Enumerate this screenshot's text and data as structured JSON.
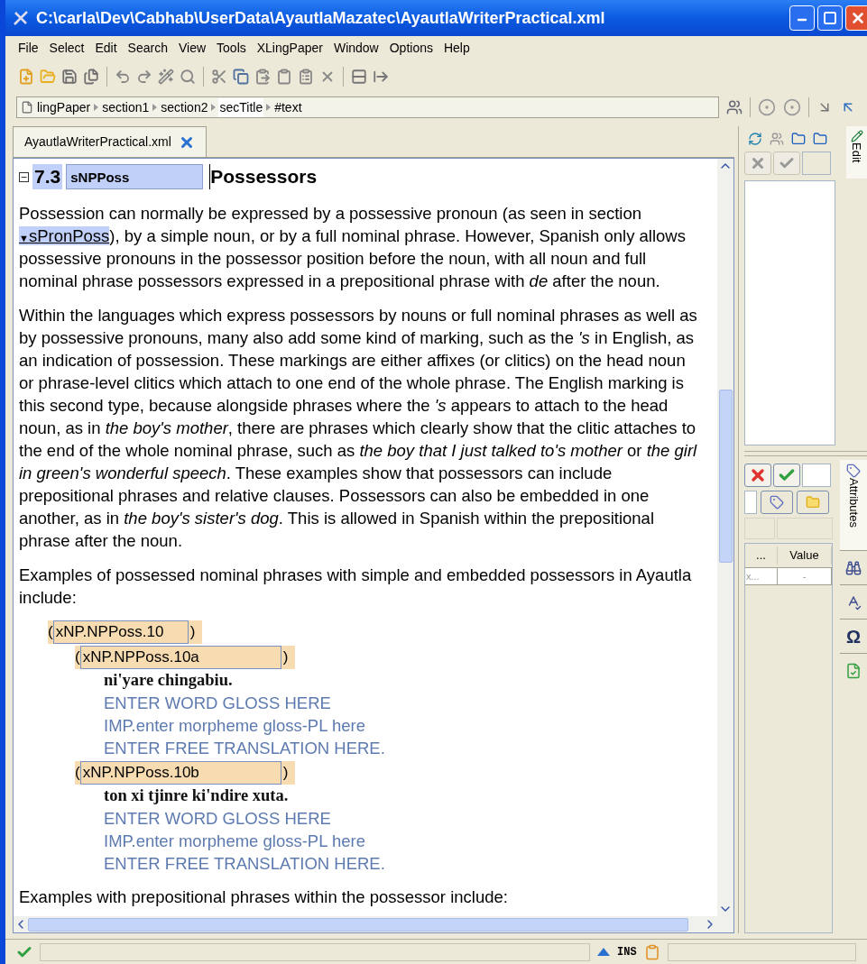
{
  "window": {
    "title": "C:\\carla\\Dev\\Cabhab\\UserData\\AyautlaMazatec\\AyautlaWriterPractical.xml"
  },
  "menu": [
    "File",
    "Select",
    "Edit",
    "Search",
    "View",
    "Tools",
    "XLingPaper",
    "Window",
    "Options",
    "Help"
  ],
  "breadcrumb": [
    {
      "label": "lingPaper",
      "selected": false
    },
    {
      "label": "section1",
      "selected": false
    },
    {
      "label": "section2",
      "selected": false
    },
    {
      "label": "secTitle",
      "selected": true
    },
    {
      "label": "#text",
      "selected": false
    }
  ],
  "tab": {
    "label": "AyautlaWriterPractical.xml"
  },
  "section": {
    "number": "7.3",
    "id": "sNPPoss",
    "title": "Possessors",
    "expanded": true
  },
  "blocks": [
    {
      "kind": "paragraph",
      "text": "Possession can normally be expressed by a possessive pronoun (as seen in section",
      "link_marker": "▼",
      "link": "sPronPoss",
      "after": "), by a simple noun, or by a full nominal phrase. However, Spanish only allows possessive pronouns in the possessor position before the noun, with all noun and full nominal phrase possessors expressed in a prepositional phrase with *de* after the noun."
    },
    {
      "kind": "paragraph",
      "text": "Within the languages which express possessors by nouns or full nominal phrases as well as by possessive pronouns, many also add some kind of marking, such as the *'s* in English, as an indication of possession. These markings are either affixes (or clitics) on the head noun or phrase-level clitics which attach to one end of the whole phrase. The English marking is this second type, because alongside phrases where the *'s* appears to attach to the head noun, as in *the boy's mother*, there are phrases which clearly show that the clitic attaches to the end of the whole nominal phrase, such as *the boy that I just talked to's mother* or *the girl in green's wonderful speech*. These examples show that possessors can include prepositional phrases and relative clauses. Possessors can also be embedded in one another, as in *the boy's sister's dog*. This is allowed in Spanish within the prepositional phrase after the noun."
    },
    {
      "kind": "paragraph",
      "text": "Examples of possessed nominal phrases with simple and embedded possessors in Ayautla include:"
    },
    {
      "kind": "example",
      "open": "(",
      "label": "xNP.NPPoss.10",
      "close": ")",
      "items": [
        {
          "open": "(",
          "label": "xNP.NPPoss.10a",
          "close": ")",
          "vernacular": "ni'yare chingabiu.",
          "word_gloss": "ENTER WORD GLOSS HERE",
          "morpheme_gloss": "IMP.enter morpheme gloss-PL here",
          "free_translation": "ENTER FREE TRANSLATION HERE."
        },
        {
          "open": "(",
          "label": "xNP.NPPoss.10b",
          "close": ")",
          "vernacular": "ton xi tjinre ki'ndire xuta.",
          "word_gloss": "ENTER WORD GLOSS HERE",
          "morpheme_gloss": "IMP.enter morpheme gloss-PL here",
          "free_translation": "ENTER FREE TRANSLATION HERE."
        }
      ]
    },
    {
      "kind": "paragraph",
      "text": "Examples with prepositional phrases within the possessor include:"
    }
  ],
  "side_tabs": [
    {
      "label": "Edit"
    },
    {
      "label": "Attributes"
    }
  ],
  "attributes": {
    "columns": [
      "...",
      "Value"
    ],
    "rows": [
      [
        "x...",
        "-"
      ]
    ]
  },
  "tool_tabs": [
    {
      "kind": "find"
    },
    {
      "kind": "spell"
    },
    {
      "kind": "glyph",
      "text": "Ω"
    },
    {
      "kind": "validate"
    }
  ],
  "status_bar": {
    "valid": true,
    "mode": "INS"
  }
}
